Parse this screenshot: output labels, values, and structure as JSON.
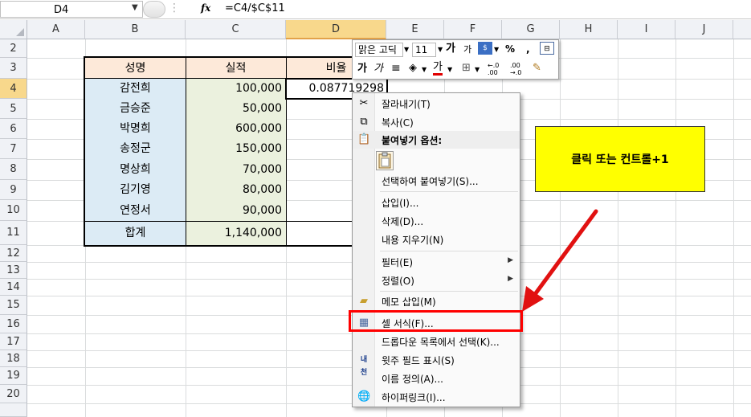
{
  "formula_bar": {
    "name_box": "D4",
    "fx_label": "fx",
    "formula": "=C4/$C$11"
  },
  "columns": [
    "A",
    "B",
    "C",
    "D",
    "E",
    "F",
    "G",
    "H",
    "I",
    "J"
  ],
  "rows": [
    "2",
    "3",
    "4",
    "5",
    "6",
    "7",
    "8",
    "9",
    "10",
    "11",
    "12",
    "13",
    "14",
    "15",
    "16",
    "17",
    "18",
    "19",
    "20"
  ],
  "table": {
    "headers": [
      "성명",
      "실적",
      "비율"
    ],
    "names": [
      "감전희",
      "금승준",
      "박명희",
      "송정군",
      "명상희",
      "김기영",
      "연정서",
      "합계"
    ],
    "values": [
      "100,000",
      "50,000",
      "600,000",
      "150,000",
      "70,000",
      "80,000",
      "90,000",
      "1,140,000"
    ],
    "ratio_d4": "0.087719298"
  },
  "mini_toolbar": {
    "font_name": "맑은 고딕",
    "font_size": "11",
    "grow_font": "가",
    "shrink_font": "가",
    "percent": "%",
    "comma": ",",
    "bold": "가",
    "italic": "가",
    "font_color": "가",
    "inc_decimal": "←.0 .00",
    "dec_decimal": ".00 →.0"
  },
  "context_menu": {
    "items": [
      {
        "label": "잘라내기(T)",
        "icon": "scissors-icon"
      },
      {
        "label": "복사(C)",
        "icon": "copy-icon"
      },
      {
        "label": "붙여넣기 옵션:",
        "icon": "paste-icon"
      },
      {
        "label": "선택하여 붙여넣기(S)..."
      },
      {
        "label": "삽입(I)..."
      },
      {
        "label": "삭제(D)..."
      },
      {
        "label": "내용 지우기(N)"
      },
      {
        "label": "필터(E)",
        "submenu": true
      },
      {
        "label": "정렬(O)",
        "submenu": true
      },
      {
        "label": "메모 삽입(M)",
        "icon": "comment-icon"
      },
      {
        "label": "셀 서식(F)...",
        "icon": "format-cells-icon"
      },
      {
        "label": "드롭다운 목록에서 선택(K)..."
      },
      {
        "label": "윗주 필드 표시(S)",
        "icon": "phonetic-icon"
      },
      {
        "label": "이름 정의(A)..."
      },
      {
        "label": "하이퍼링크(I)...",
        "icon": "hyperlink-icon"
      }
    ]
  },
  "callout": {
    "text": "클릭 또는 컨트롤+1"
  },
  "colors": {
    "header_fill": "#fde9d9",
    "name_fill": "#dcebf5",
    "value_fill": "#ebf1de",
    "highlight": "#ff0000",
    "callout_fill": "#ffff00"
  }
}
